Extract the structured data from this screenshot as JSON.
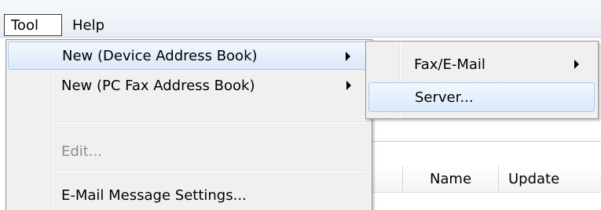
{
  "menubar": {
    "items": [
      {
        "label": "Tool"
      },
      {
        "label": "Help"
      }
    ]
  },
  "tool_menu": {
    "items": [
      {
        "label": "New (Device Address Book)",
        "has_submenu": true,
        "highlighted": true
      },
      {
        "label": "New (PC Fax Address Book)",
        "has_submenu": true
      },
      {
        "label": "Edit...",
        "disabled": true
      },
      {
        "label": "E-Mail Message Settings..."
      }
    ]
  },
  "submenu": {
    "items": [
      {
        "label": "Fax/E-Mail",
        "has_submenu": true
      },
      {
        "label": "Server...",
        "highlighted": true
      }
    ]
  },
  "list": {
    "columns": [
      "Name",
      "Update"
    ]
  },
  "colors": {
    "highlight_border": "#a8c8ee",
    "highlight_fill": "#dbe9fa",
    "menu_bg": "#f0f0f0",
    "disabled_text": "#8d8d8d"
  }
}
